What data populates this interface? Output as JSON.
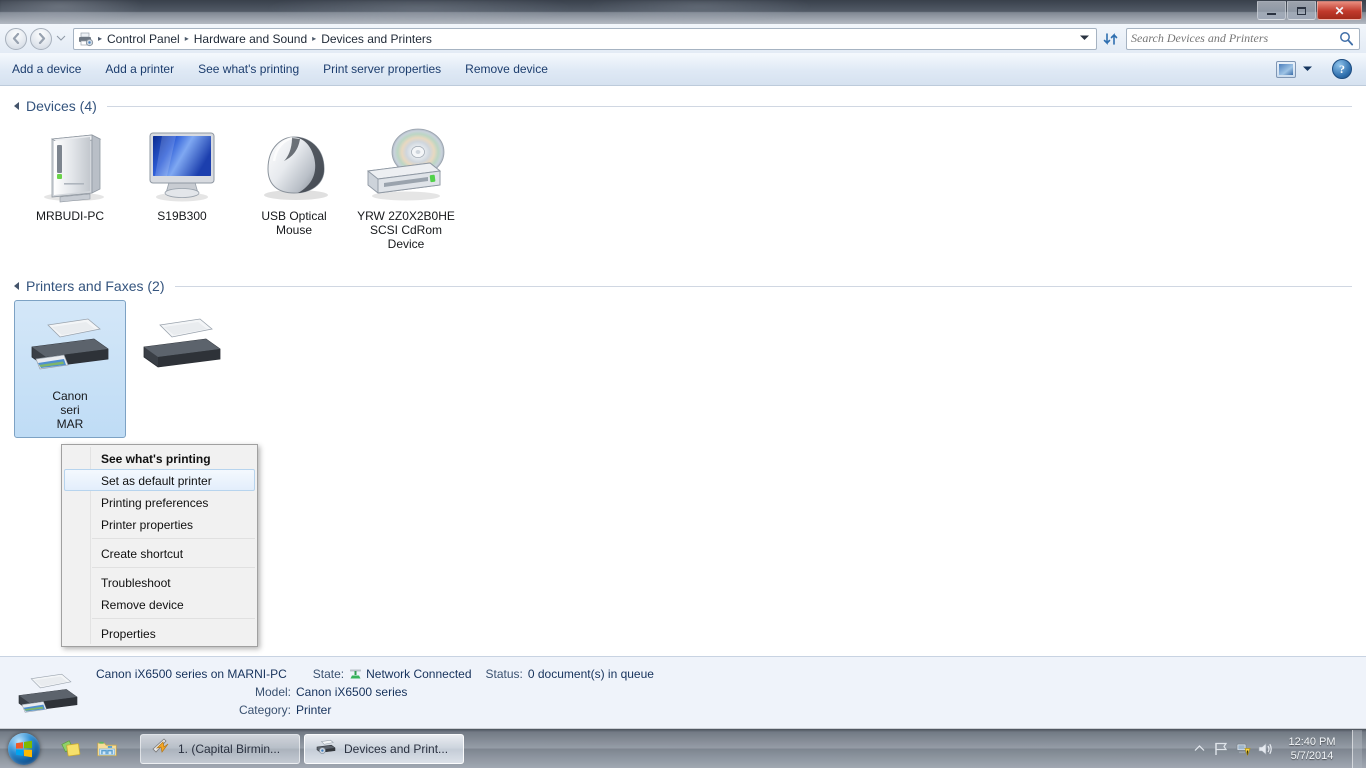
{
  "window": {
    "title": "Devices and Printers",
    "minimize_label": "Minimize",
    "maximize_label": "Maximize",
    "close_label": "Close"
  },
  "nav": {
    "back_label": "Back",
    "forward_label": "Forward",
    "history_label": "Recent pages",
    "breadcrumbs": [
      "Control Panel",
      "Hardware and Sound",
      "Devices and Printers"
    ],
    "separator": "▸",
    "address_chevron": "▾",
    "refresh_label": "Refresh"
  },
  "search": {
    "placeholder": "Search Devices and Printers",
    "value": ""
  },
  "commandbar": {
    "items": [
      {
        "label": "Add a device"
      },
      {
        "label": "Add a printer"
      },
      {
        "label": "See what's printing"
      },
      {
        "label": "Print server properties"
      },
      {
        "label": "Remove device"
      }
    ],
    "view_chevron": "▾",
    "help_label": "?"
  },
  "groups": [
    {
      "title": "Devices (4)",
      "items": [
        {
          "label": "MRBUDI-PC",
          "icon": "computer-tower-icon"
        },
        {
          "label": "S19B300",
          "icon": "monitor-icon"
        },
        {
          "label": "USB Optical Mouse",
          "icon": "mouse-icon"
        },
        {
          "label": "YRW 2Z0X2B0HE SCSI CdRom Device",
          "icon": "cdrom-drive-icon"
        }
      ]
    },
    {
      "title": "Printers and Faxes (2)",
      "items": [
        {
          "label": "Canon iX6500 series on MARNI-PC",
          "icon": "printer-icon",
          "selected": true
        },
        {
          "label": "",
          "icon": "printer-icon",
          "selected": false
        }
      ]
    }
  ],
  "selected_printer_label_lines": [
    "Canon",
    "seri",
    "MAR"
  ],
  "context_menu": {
    "items": [
      {
        "label": "See what's printing",
        "bold": true,
        "highlighted": false,
        "separator_after": false
      },
      {
        "label": "Set as default printer",
        "bold": false,
        "highlighted": true,
        "separator_after": false
      },
      {
        "label": "Printing preferences",
        "bold": false,
        "highlighted": false,
        "separator_after": false
      },
      {
        "label": "Printer properties",
        "bold": false,
        "highlighted": false,
        "separator_after": true
      },
      {
        "label": "Create shortcut",
        "bold": false,
        "highlighted": false,
        "separator_after": true
      },
      {
        "label": "Troubleshoot",
        "bold": false,
        "highlighted": false,
        "separator_after": false
      },
      {
        "label": "Remove device",
        "bold": false,
        "highlighted": false,
        "separator_after": true
      },
      {
        "label": "Properties",
        "bold": false,
        "highlighted": false,
        "separator_after": false
      }
    ]
  },
  "details": {
    "name": "Canon iX6500 series on MARNI-PC",
    "state_key": "State:",
    "state_value": "Network Connected",
    "state_icon": "network-connected-icon",
    "status_key": "Status:",
    "status_value": "0 document(s) in queue",
    "model_key": "Model:",
    "model_value": "Canon iX6500 series",
    "category_key": "Category:",
    "category_value": "Printer"
  },
  "taskbar": {
    "start_label": "Start",
    "quick_launch": [
      {
        "name": "media-gallery-icon"
      },
      {
        "name": "windows-explorer-icon"
      }
    ],
    "tasks": [
      {
        "label": "1. (Capital Birmin...",
        "icon": "winamp-icon",
        "active": false
      },
      {
        "label": "Devices and Print...",
        "icon": "printer-icon",
        "active": true
      }
    ],
    "tray_arrow": "▴",
    "tray_icons": [
      "action-center-flag-icon",
      "network-warning-icon",
      "volume-icon"
    ],
    "time": "12:40 PM",
    "date": "5/7/2014",
    "show_desktop_label": "Show desktop"
  },
  "colors": {
    "accent_blue": "#1c3d6e",
    "group_header": "#34547e",
    "selection_fill": "#bfdcf5",
    "selection_border": "#7da2c4",
    "status_bar_bg": "#eff3fa",
    "network_green": "#3fa653",
    "close_red": "#c0392b"
  }
}
